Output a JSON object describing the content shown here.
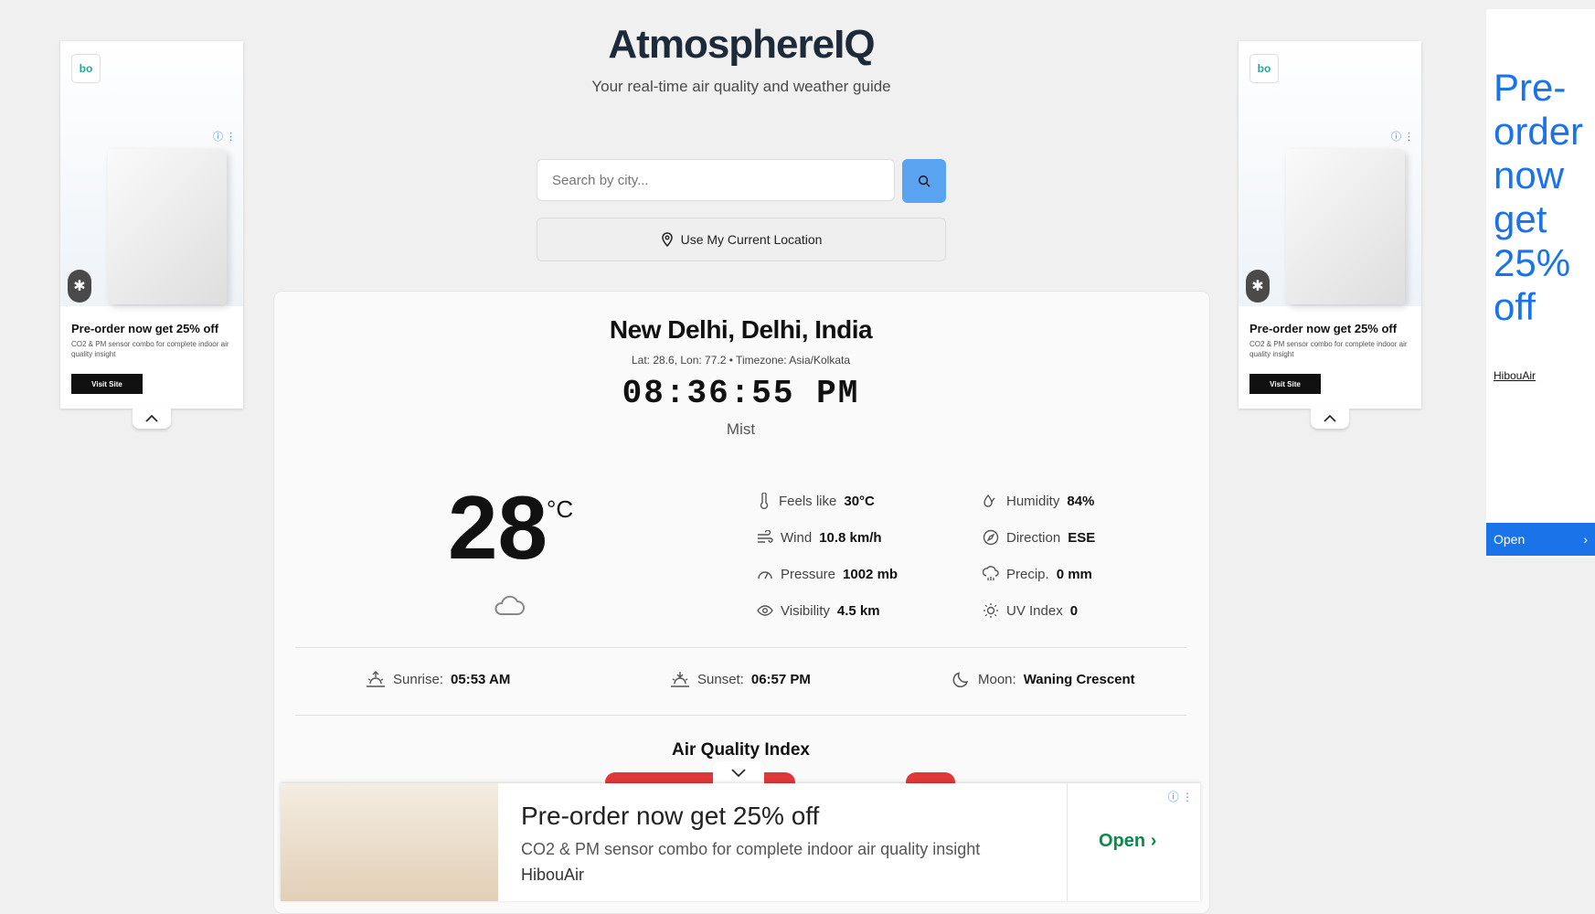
{
  "header": {
    "title": "AtmosphereIQ",
    "tagline": "Your real-time air quality and weather guide"
  },
  "search": {
    "placeholder": "Search by city...",
    "location_label": "Use My Current Location"
  },
  "location": {
    "name": "New Delhi, Delhi, India",
    "meta": "Lat: 28.6, Lon: 77.2 • Timezone: Asia/Kolkata",
    "time": "08:36:55 PM",
    "condition": "Mist"
  },
  "current": {
    "temperature": "28",
    "unit": "°C"
  },
  "stats": {
    "feels_like": {
      "label": "Feels like",
      "value": "30°C"
    },
    "wind": {
      "label": "Wind",
      "value": "10.8 km/h"
    },
    "pressure": {
      "label": "Pressure",
      "value": "1002 mb"
    },
    "visibility": {
      "label": "Visibility",
      "value": "4.5 km"
    },
    "humidity": {
      "label": "Humidity",
      "value": "84%"
    },
    "direction": {
      "label": "Direction",
      "value": "ESE"
    },
    "precip": {
      "label": "Precip.",
      "value": "0 mm"
    },
    "uv": {
      "label": "UV Index",
      "value": "0"
    }
  },
  "astro": {
    "sunrise": {
      "label": "Sunrise:",
      "value": "05:53 AM"
    },
    "sunset": {
      "label": "Sunset:",
      "value": "06:57 PM"
    },
    "moon": {
      "label": "Moon:",
      "value": "Waning Crescent"
    }
  },
  "aqi": {
    "title": "Air Quality Index"
  },
  "ads": {
    "side": {
      "logo": "bo",
      "headline": "Pre-order now get 25% off",
      "desc": "CO2 & PM sensor combo for complete indoor air quality insight",
      "cta": "Visit Site"
    },
    "right": {
      "text": "Pre-order now get 25% off",
      "brand": "HibouAir",
      "cta": "Open"
    },
    "bottom": {
      "headline": "Pre-order now get 25% off",
      "desc": "CO2 & PM sensor combo for complete indoor air quality insight",
      "brand": "HibouAir",
      "cta": "Open"
    }
  },
  "colors": {
    "accent": "#5aa3f0",
    "aqi_bad": "#e03838",
    "ad_blue": "#1a73e8",
    "ad_green": "#0b8a4a"
  }
}
